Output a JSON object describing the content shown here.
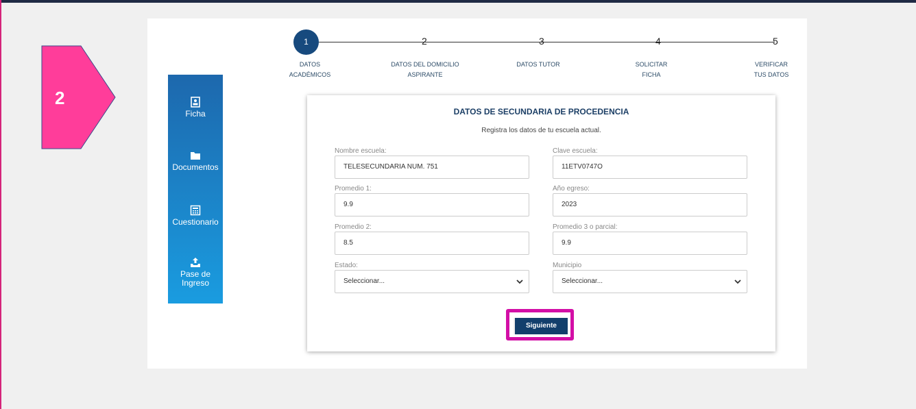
{
  "callout": {
    "number": "2",
    "color": "#e8348b"
  },
  "sidebar": {
    "items": [
      {
        "label": "Ficha",
        "icon": "id-card-icon"
      },
      {
        "label": "Documentos",
        "icon": "folder-icon"
      },
      {
        "label": "Cuestionario",
        "icon": "calculator-icon"
      },
      {
        "label": "Pase de Ingreso",
        "icon": "upload-tray-icon"
      }
    ]
  },
  "stepper": {
    "steps": [
      {
        "num": "1",
        "label_line1": "DATOS",
        "label_line2": "ACADÉMICOS",
        "active": true
      },
      {
        "num": "2",
        "label_line1": "DATOS DEL DOMICILIO",
        "label_line2": "ASPIRANTE"
      },
      {
        "num": "3",
        "label_line1": "DATOS TUTOR",
        "label_line2": ""
      },
      {
        "num": "4",
        "label_line1": "SOLICITAR",
        "label_line2": "FICHA"
      },
      {
        "num": "5",
        "label_line1": "VERIFICAR",
        "label_line2": "TUS DATOS"
      }
    ]
  },
  "form": {
    "title": "DATOS DE SECUNDARIA DE PROCEDENCIA",
    "subtitle": "Registra los datos de tu escuela actual.",
    "nombre_escuela": {
      "label": "Nombre escuela:",
      "value": "TELESECUNDARIA NUM. 751"
    },
    "clave_escuela": {
      "label": "Clave escuela:",
      "value": "11ETV0747O"
    },
    "promedio1": {
      "label": "Promedio 1:",
      "value": "9.9"
    },
    "anio_egreso": {
      "label": "Año egreso:",
      "value": "2023"
    },
    "promedio2": {
      "label": "Promedio 2:",
      "value": "8.5"
    },
    "promedio3": {
      "label": "Promedio 3 o parcial:",
      "value": "9.9"
    },
    "estado": {
      "label": "Estado:",
      "value": "Seleccionar..."
    },
    "municipio": {
      "label": "Municipio",
      "value": "Seleccionar..."
    },
    "submit_label": "Siguiente"
  },
  "colors": {
    "accent": "#174a7e",
    "highlight": "#d30fa6",
    "sidebar_top": "#1d68ad",
    "sidebar_bottom": "#1a9ce0"
  }
}
